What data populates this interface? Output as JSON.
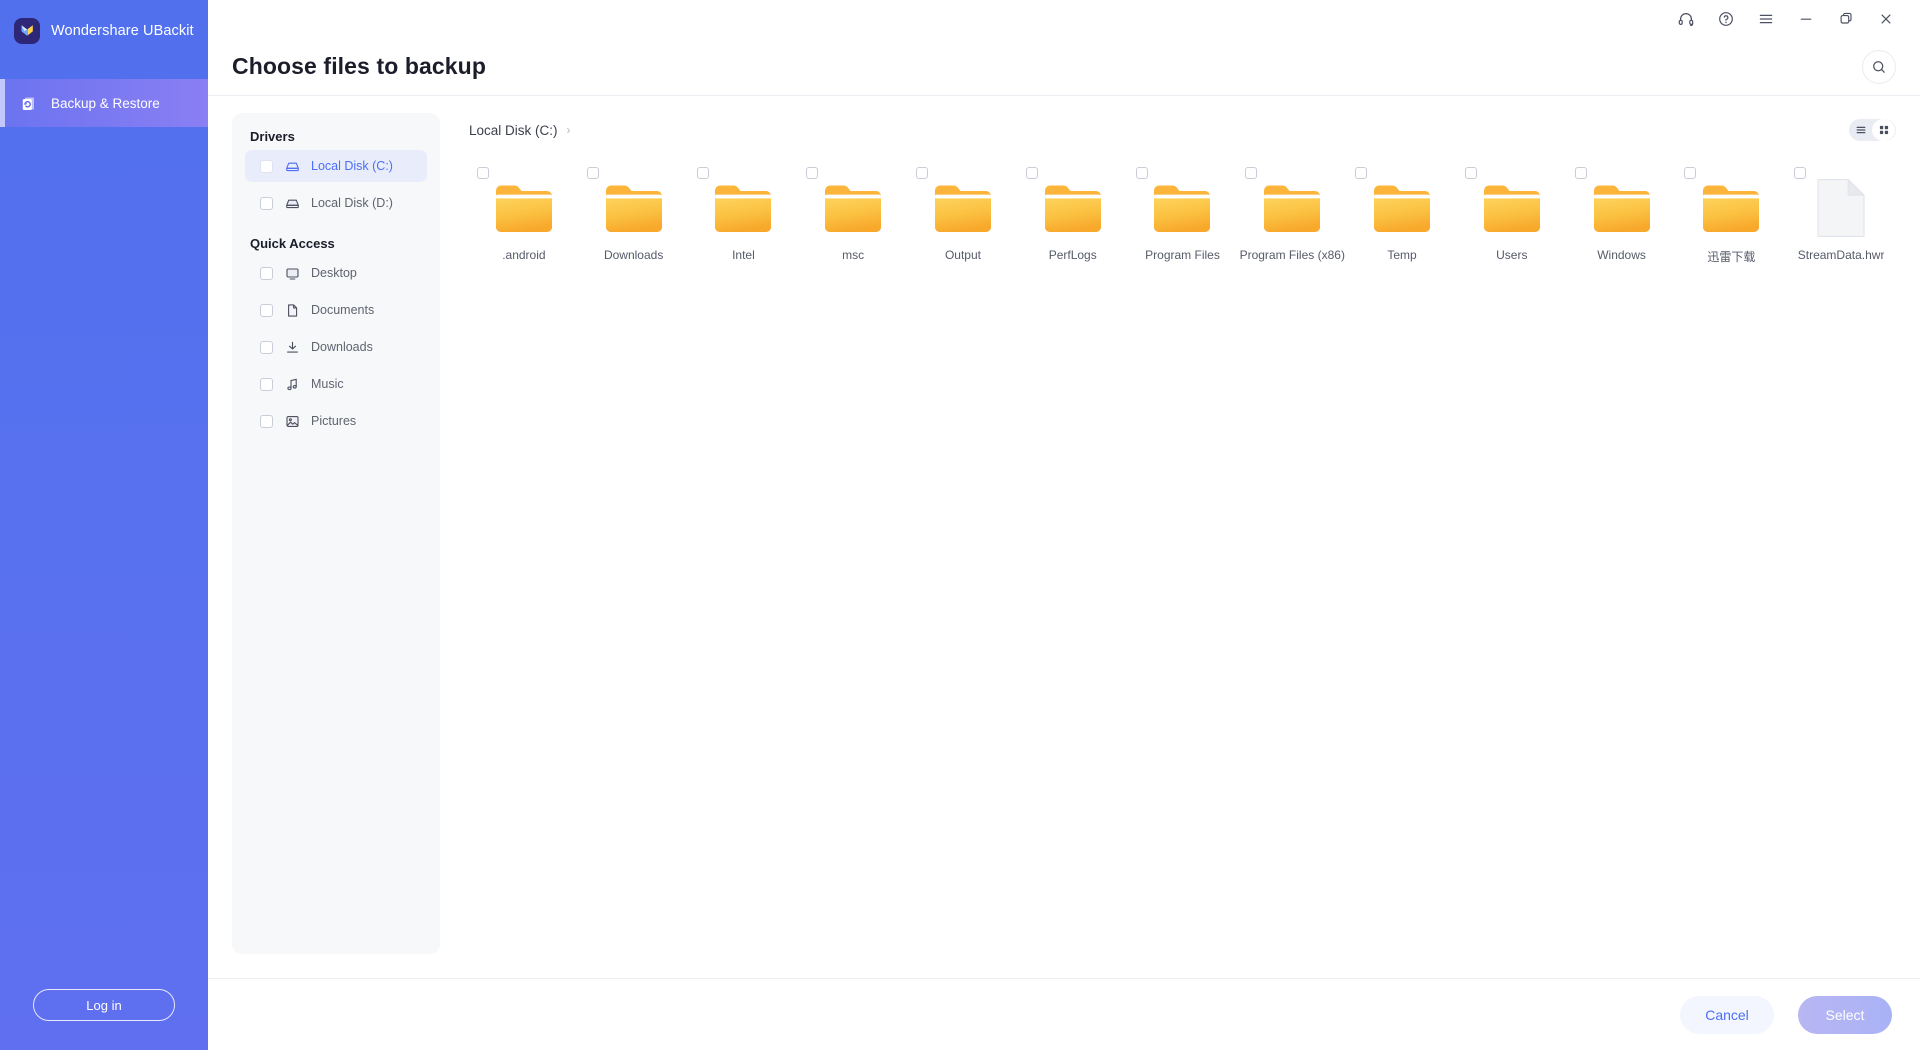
{
  "app": {
    "brand": "Wondershare UBackit",
    "logo_icon": "butterfly-logo-icon"
  },
  "leftnav": {
    "items": [
      {
        "label": "Backup & Restore",
        "icon": "backup-restore-icon",
        "active": true
      }
    ],
    "login_label": "Log in"
  },
  "titlebar": {
    "buttons": [
      {
        "name": "support-headset-icon",
        "glyph": "headset"
      },
      {
        "name": "help-icon",
        "glyph": "help"
      },
      {
        "name": "menu-icon",
        "glyph": "menu"
      },
      {
        "name": "minimize-icon",
        "glyph": "minimize"
      },
      {
        "name": "maximize-icon",
        "glyph": "maximize"
      },
      {
        "name": "close-icon",
        "glyph": "close"
      }
    ]
  },
  "header": {
    "title": "Choose files to backup",
    "search_icon": "search-icon"
  },
  "tree": {
    "groups": [
      {
        "title": "Drivers",
        "items": [
          {
            "label": "Local Disk (C:)",
            "icon": "hard-drive-icon",
            "selected": true,
            "checked": false
          },
          {
            "label": "Local Disk (D:)",
            "icon": "hard-drive-icon",
            "selected": false,
            "checked": false
          }
        ]
      },
      {
        "title": "Quick Access",
        "items": [
          {
            "label": "Desktop",
            "icon": "monitor-icon",
            "selected": false,
            "checked": false
          },
          {
            "label": "Documents",
            "icon": "document-icon",
            "selected": false,
            "checked": false
          },
          {
            "label": "Downloads",
            "icon": "download-icon",
            "selected": false,
            "checked": false
          },
          {
            "label": "Music",
            "icon": "music-note-icon",
            "selected": false,
            "checked": false
          },
          {
            "label": "Pictures",
            "icon": "image-icon",
            "selected": false,
            "checked": false
          }
        ]
      }
    ]
  },
  "breadcrumb": {
    "path": [
      "Local Disk (C:)"
    ],
    "separator": "›"
  },
  "viewtoggle": {
    "list_icon": "list-view-icon",
    "grid_icon": "grid-view-icon",
    "active": "grid"
  },
  "files": [
    {
      "name": ".android",
      "type": "folder",
      "checked": false
    },
    {
      "name": "Downloads",
      "type": "folder",
      "checked": false
    },
    {
      "name": "Intel",
      "type": "folder",
      "checked": false
    },
    {
      "name": "msc",
      "type": "folder",
      "checked": false
    },
    {
      "name": "Output",
      "type": "folder",
      "checked": false
    },
    {
      "name": "PerfLogs",
      "type": "folder",
      "checked": false
    },
    {
      "name": "Program Files",
      "type": "folder",
      "checked": false
    },
    {
      "name": "Program Files (x86)",
      "type": "folder",
      "checked": false
    },
    {
      "name": "Temp",
      "type": "folder",
      "checked": false
    },
    {
      "name": "Users",
      "type": "folder",
      "checked": false
    },
    {
      "name": "Windows",
      "type": "folder",
      "checked": false
    },
    {
      "name": "迅雷下载",
      "type": "folder",
      "checked": false
    },
    {
      "name": "StreamData.hwr",
      "type": "file",
      "checked": false
    }
  ],
  "footer": {
    "cancel_label": "Cancel",
    "select_label": "Select"
  },
  "colors": {
    "brand_blue": "#5170ee",
    "accent_blue": "#4d6ef5",
    "folder_yellow": "#fbc140",
    "nav_active_purple": "#8a7ff3",
    "panel_bg": "#f7f8fa"
  }
}
